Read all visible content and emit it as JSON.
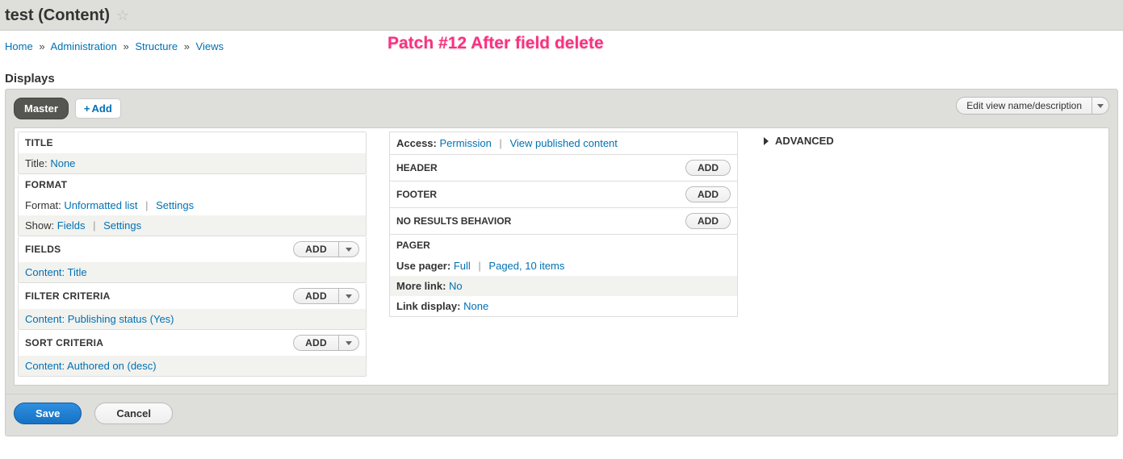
{
  "page_title": "test (Content)",
  "annotation": "Patch #12 After field delete",
  "breadcrumb": {
    "home": "Home",
    "admin": "Administration",
    "structure": "Structure",
    "views": "Views"
  },
  "displays_heading": "Displays",
  "tabs": {
    "master": "Master",
    "add": "Add"
  },
  "edit_view_label": "Edit view name/description",
  "col1": {
    "title_section": {
      "header": "TITLE",
      "label": "Title:",
      "value": "None"
    },
    "format_section": {
      "header": "FORMAT",
      "format_label": "Format:",
      "format_value": "Unformatted list",
      "format_settings": "Settings",
      "show_label": "Show:",
      "show_value": "Fields",
      "show_settings": "Settings"
    },
    "fields_section": {
      "header": "FIELDS",
      "add": "Add",
      "row1": "Content: Title"
    },
    "filter_section": {
      "header": "FILTER CRITERIA",
      "add": "Add",
      "row1": "Content: Publishing status (Yes)"
    },
    "sort_section": {
      "header": "SORT CRITERIA",
      "add": "Add",
      "row1": "Content: Authored on (desc)"
    }
  },
  "col2": {
    "access": {
      "label": "Access:",
      "value": "Permission",
      "detail": "View published content"
    },
    "header_section": {
      "header": "HEADER",
      "add": "Add"
    },
    "footer_section": {
      "header": "FOOTER",
      "add": "Add"
    },
    "noresults_section": {
      "header": "NO RESULTS BEHAVIOR",
      "add": "Add"
    },
    "pager_section": {
      "header": "PAGER",
      "use_pager_label": "Use pager:",
      "use_pager_value": "Full",
      "use_pager_detail": "Paged, 10 items",
      "more_link_label": "More link:",
      "more_link_value": "No",
      "link_display_label": "Link display:",
      "link_display_value": "None"
    }
  },
  "advanced_label": "ADVANCED",
  "actions": {
    "save": "Save",
    "cancel": "Cancel"
  }
}
